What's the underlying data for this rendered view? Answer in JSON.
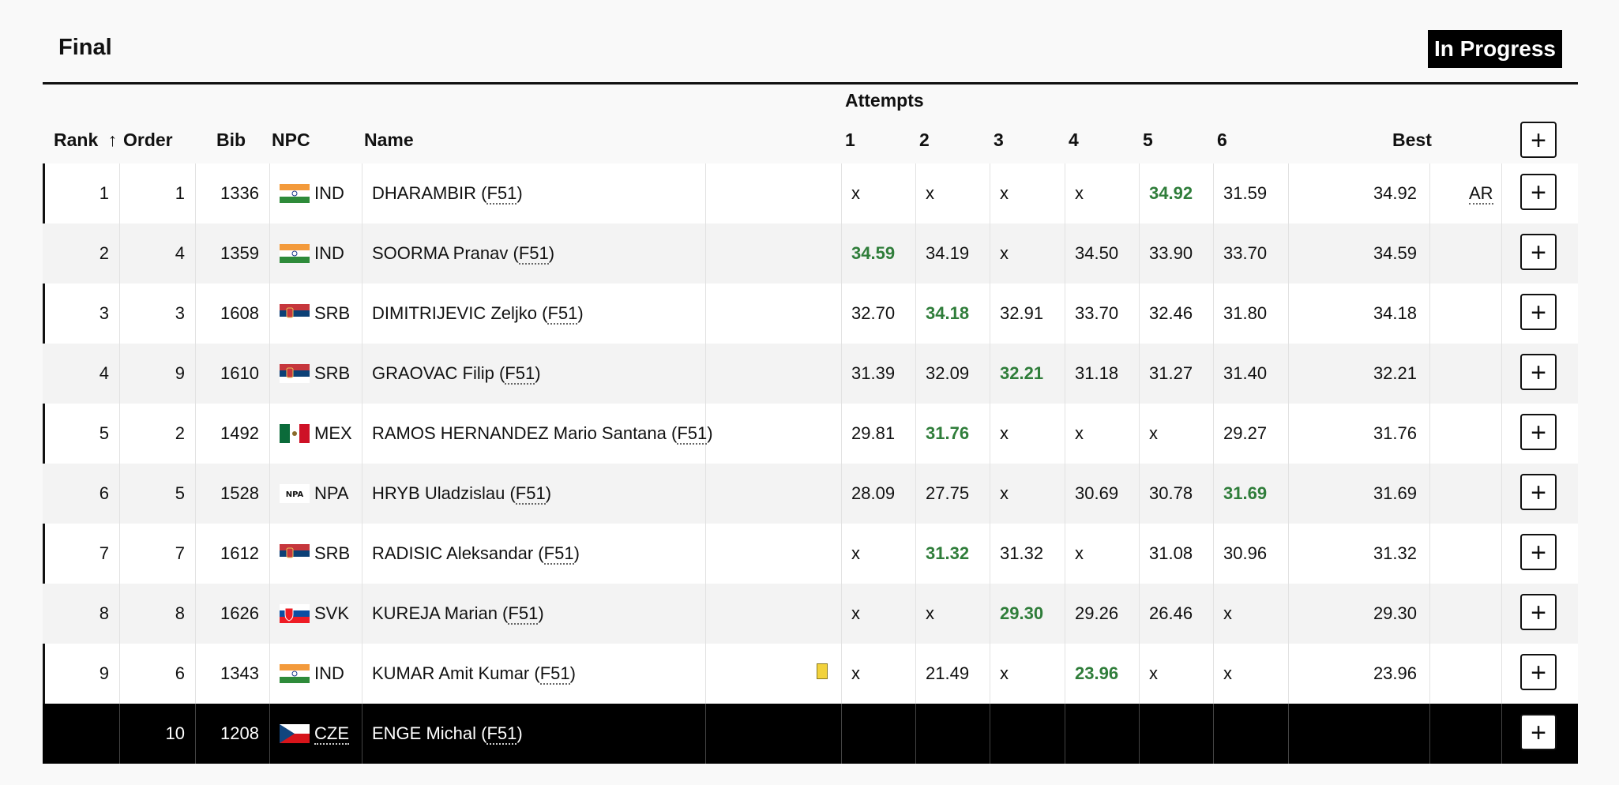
{
  "header": {
    "title": "Final",
    "status": "In Progress"
  },
  "columns": {
    "rank": "Rank",
    "rank_sort_icon": "↑",
    "order": "Order",
    "bib": "Bib",
    "npc": "NPC",
    "name": "Name",
    "attempts": "Attempts",
    "attempt_nums": [
      "1",
      "2",
      "3",
      "4",
      "5",
      "6"
    ],
    "best": "Best",
    "add_icon": "+"
  },
  "colors": {
    "good": "#2f7d3a",
    "card": "#f2d23c"
  },
  "rows": [
    {
      "rank": "1",
      "order": "1",
      "bib": "1336",
      "flag": "india-flag-icon",
      "npc": "IND",
      "name": "DHARAMBIR (",
      "cls": "F51",
      "close": ")",
      "attempts": [
        "x",
        "x",
        "x",
        "x",
        "34.92",
        "31.59"
      ],
      "good": 4,
      "best": "34.92",
      "record": "AR"
    },
    {
      "rank": "2",
      "order": "4",
      "bib": "1359",
      "flag": "india-flag-icon",
      "npc": "IND",
      "name": "SOORMA Pranav (",
      "cls": "F51",
      "close": ")",
      "attempts": [
        "34.59",
        "34.19",
        "x",
        "34.50",
        "33.90",
        "33.70"
      ],
      "good": 0,
      "best": "34.59",
      "record": ""
    },
    {
      "rank": "3",
      "order": "3",
      "bib": "1608",
      "flag": "serbia-flag-icon",
      "npc": "SRB",
      "name": "DIMITRIJEVIC Zeljko (",
      "cls": "F51",
      "close": ")",
      "attempts": [
        "32.70",
        "34.18",
        "32.91",
        "33.70",
        "32.46",
        "31.80"
      ],
      "good": 1,
      "best": "34.18",
      "record": ""
    },
    {
      "rank": "4",
      "order": "9",
      "bib": "1610",
      "flag": "serbia-flag-icon",
      "npc": "SRB",
      "name": "GRAOVAC Filip (",
      "cls": "F51",
      "close": ")",
      "attempts": [
        "31.39",
        "32.09",
        "32.21",
        "31.18",
        "31.27",
        "31.40"
      ],
      "good": 2,
      "best": "32.21",
      "record": ""
    },
    {
      "rank": "5",
      "order": "2",
      "bib": "1492",
      "flag": "mexico-flag-icon",
      "npc": "MEX",
      "name": "RAMOS HERNANDEZ Mario Santana (",
      "cls": "F51",
      "close": ")",
      "attempts": [
        "29.81",
        "31.76",
        "x",
        "x",
        "x",
        "29.27"
      ],
      "good": 1,
      "best": "31.76",
      "record": ""
    },
    {
      "rank": "6",
      "order": "5",
      "bib": "1528",
      "flag": "npa-flag-icon",
      "npc": "NPA",
      "name": "HRYB Uladzislau (",
      "cls": "F51",
      "close": ")",
      "attempts": [
        "28.09",
        "27.75",
        "x",
        "30.69",
        "30.78",
        "31.69"
      ],
      "good": 5,
      "best": "31.69",
      "record": ""
    },
    {
      "rank": "7",
      "order": "7",
      "bib": "1612",
      "flag": "serbia-flag-icon",
      "npc": "SRB",
      "name": "RADISIC Aleksandar (",
      "cls": "F51",
      "close": ")",
      "attempts": [
        "x",
        "31.32",
        "31.32",
        "x",
        "31.08",
        "30.96"
      ],
      "good": 1,
      "best": "31.32",
      "record": ""
    },
    {
      "rank": "8",
      "order": "8",
      "bib": "1626",
      "flag": "slovakia-flag-icon",
      "npc": "SVK",
      "name": "KUREJA Marian (",
      "cls": "F51",
      "close": ")",
      "attempts": [
        "x",
        "x",
        "29.30",
        "29.26",
        "26.46",
        "x"
      ],
      "good": 2,
      "best": "29.30",
      "record": ""
    },
    {
      "rank": "9",
      "order": "6",
      "bib": "1343",
      "flag": "india-flag-icon",
      "npc": "IND",
      "name": "KUMAR Amit Kumar (",
      "cls": "F51",
      "close": ")",
      "yellow_card": true,
      "attempts": [
        "x",
        "21.49",
        "x",
        "23.96",
        "x",
        "x"
      ],
      "good": 3,
      "best": "23.96",
      "record": ""
    },
    {
      "rank": "",
      "order": "10",
      "bib": "1208",
      "flag": "czech-flag-icon",
      "npc": "CZE",
      "name": "ENGE Michal (",
      "cls": "F51",
      "close": ")",
      "dark": true,
      "attempts": [
        "",
        "",
        "",
        "",
        "",
        ""
      ],
      "good": -1,
      "best": "",
      "record": ""
    }
  ]
}
